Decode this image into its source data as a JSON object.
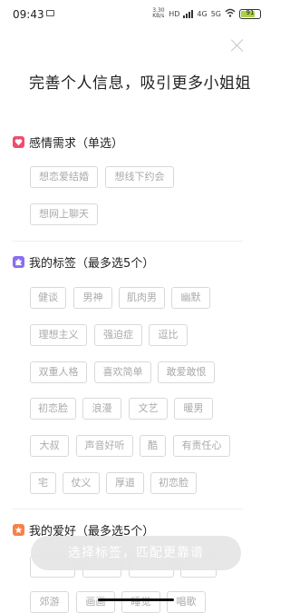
{
  "status_bar": {
    "time": "09:43",
    "net_speed": "3.30 KB/s",
    "net_label_1": "HD",
    "net_label_2": "4G",
    "net_label_3": "5G",
    "battery": "91"
  },
  "header": {
    "title": "完善个人信息，吸引更多小姐姐"
  },
  "sections": [
    {
      "icon": "heart-icon",
      "title": "感情需求（单选）",
      "tags": [
        "想恋爱结婚",
        "想线下约会",
        "想网上聊天"
      ]
    },
    {
      "icon": "puzzle-icon",
      "title": "我的标签（最多选5个）",
      "tags": [
        "健谈",
        "男神",
        "肌肉男",
        "幽默",
        "理想主义",
        "强迫症",
        "逗比",
        "双重人格",
        "喜欢简单",
        "敢爱敢恨",
        "初恋脸",
        "浪漫",
        "文艺",
        "暖男",
        "大叔",
        "声音好听",
        "酷",
        "有责任心",
        "宅",
        "仗义",
        "厚道",
        "初恋脸"
      ]
    },
    {
      "icon": "star-icon",
      "title": "我的爱好（最多选5个）",
      "tags": [
        "郊游",
        "画画",
        "睡觉",
        "唱歌"
      ]
    }
  ],
  "cta": {
    "label": "选择标签，匹配更靠谱"
  },
  "colors": {
    "accent_heart": "#ef4d6f",
    "accent_puzzle": "#8b6df0",
    "accent_star": "#f5824a",
    "cta_bg": "#e6e6e6"
  }
}
